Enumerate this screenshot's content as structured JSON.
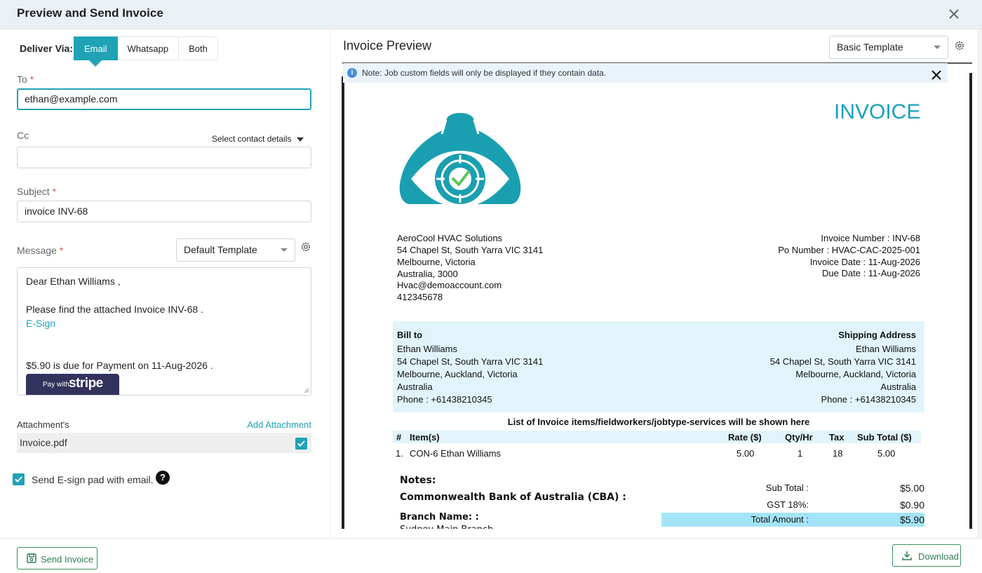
{
  "dialog": {
    "title": "Preview and Send Invoice"
  },
  "deliver": {
    "label": "Deliver Via:",
    "tabs": [
      {
        "label": "Email",
        "active": true
      },
      {
        "label": "Whatsapp",
        "active": false
      },
      {
        "label": "Both",
        "active": false
      }
    ]
  },
  "form": {
    "to_label": "To",
    "to_value": "ethan@example.com",
    "cc_label": "Cc",
    "cc_value": "",
    "select_contact_label": "Select contact details",
    "subject_label": "Subject",
    "subject_value": "invoice INV-68",
    "message_label": "Message",
    "message_template": "Default Template",
    "required_mark": "*"
  },
  "message": {
    "greeting": "Dear  Ethan Williams ,",
    "body": "Please find the attached Invoice  INV-68 .",
    "esign_link": "E-Sign",
    "due_line": " $5.90  is due for Payment on  11-Aug-2026 .",
    "stripe_pay_with": "Pay with",
    "stripe_brand": "stripe"
  },
  "attachments": {
    "label": "Attachment's",
    "add_label": "Add Attachment",
    "file_name": "Invoice.pdf",
    "file_checked": true
  },
  "esign_pad": {
    "label": "Send E-sign pad with email.",
    "checked": true,
    "help": "?"
  },
  "preview": {
    "title": "Invoice Preview",
    "template": "Basic Template",
    "note_icon": "i",
    "note": "Note: Job custom fields will only be displayed if they contain data."
  },
  "invoice": {
    "heading": "INVOICE",
    "company": {
      "name": "AeroCool HVAC Solutions",
      "street": "54 Chapel St, South Yarra VIC 3141",
      "city": "Melbourne, Victoria",
      "country": "Australia, 3000",
      "email": "Hvac@demoaccount.com",
      "phone": "412345678"
    },
    "meta": {
      "invoice_number": "Invoice Number : INV-68",
      "po_number": "Po Number : HVAC-CAC-2025-001",
      "invoice_date": "Invoice Date : 11-Aug-2026",
      "due_date": "Due Date : 11-Aug-2026"
    },
    "bill_to": {
      "title": "Bill to",
      "name": "Ethan Williams",
      "street": "54 Chapel St, South Yarra VIC 3141",
      "city": "Melbourne, Auckland, Victoria",
      "country": "Australia",
      "phone": "Phone : +61438210345"
    },
    "shipping": {
      "title": "Shipping Address",
      "name": "Ethan Williams",
      "street": "54 Chapel St, South Yarra VIC 3141",
      "city": "Melbourne, Auckland, Victoria",
      "country": "Australia",
      "phone": "Phone : +61438210345"
    },
    "items_caption": "List of Invoice items/fieldworkers/jobtype-services will be shown here",
    "columns": {
      "num": "#",
      "item": "Item(s)",
      "rate": "Rate ($)",
      "qty": "Qty/Hr",
      "tax": "Tax",
      "subtotal": "Sub Total ($)"
    },
    "items": [
      {
        "num": "1.",
        "item": "CON-6 Ethan Williams",
        "rate": "5.00",
        "qty": "1",
        "tax": "18",
        "subtotal": "5.00"
      }
    ],
    "notes_label": "Notes:",
    "bank": "Commonwealth Bank of Australia (CBA) :",
    "branch": "Branch Name: :",
    "branch_value": "Sydney Main Branch",
    "totals": {
      "sub_total_label": "Sub Total :",
      "sub_total_value": "$5.00",
      "gst_label": "GST 18%:",
      "gst_value": "$0.90",
      "total_label": "Total Amount :",
      "total_value": "$5.90"
    }
  },
  "footer": {
    "send_label": "Send Invoice",
    "download_label": "Download"
  },
  "colors": {
    "accent": "#1fa2b5",
    "invoice_heading": "#1a9fc0",
    "billbox": "#e1f4fb",
    "total_highlight": "#a4e4f8",
    "footer_button": "#2e7d52"
  }
}
